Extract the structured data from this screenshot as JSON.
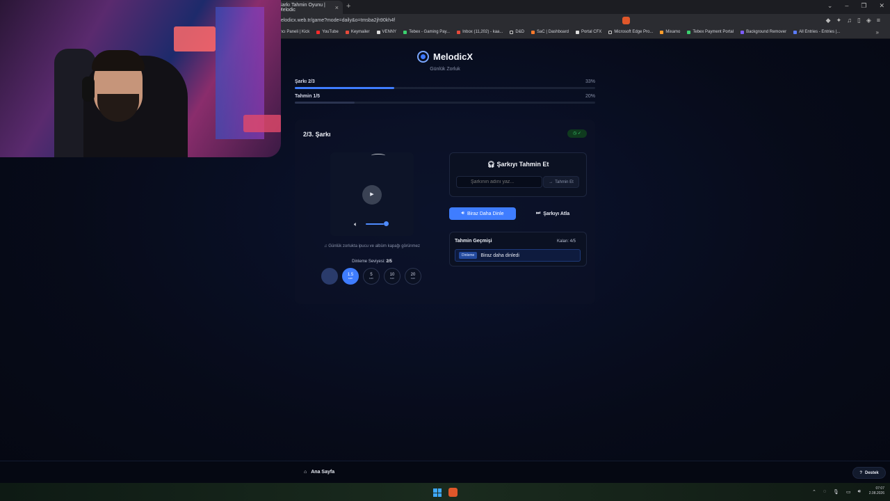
{
  "browser": {
    "tab_title": "Şarkı Tahmin Oyunu | Melodic",
    "url": "melodicx.web.tr/game?mode=daily&o=tmsba2jh90kh4f",
    "bookmarks": [
      "yıncı Paneli | Kick",
      "YouTube",
      "Keymailer",
      "VENNY",
      "Tebex - Gaming Pay...",
      "Inbox (11,202) - kaa...",
      "D&D",
      "SaC | Dashboard",
      "Portal CFX",
      "Microsoft Edge Pro...",
      "Mixamo",
      "Tebex Payment Portal",
      "Background Remover",
      "All Entries - Entries |..."
    ]
  },
  "header": {
    "logo_text": "MelodicX",
    "subtitle": "Günlük Zorluk"
  },
  "progress": {
    "song_label": "Şarkı 2/3",
    "song_pct": "33%",
    "song_fraction": 0.33,
    "guess_label": "Tahmin 1/5",
    "guess_pct": "20%",
    "guess_fraction": 0.2
  },
  "player": {
    "song_title": "2/3. Şarkı",
    "hint": "♫ Günlük zorlukta ipucu ve albüm kapağı görünmez",
    "volume_fraction": 0.85,
    "level_label": "Dinleme Seviyesi:",
    "level_value": "2/5",
    "levels": [
      {
        "value": "",
        "unit": ""
      },
      {
        "value": "1.5",
        "unit": "san"
      },
      {
        "value": "5",
        "unit": "san"
      },
      {
        "value": "10",
        "unit": "san"
      },
      {
        "value": "20",
        "unit": "san"
      }
    ]
  },
  "guess": {
    "title": "Şarkıyı Tahmin Et",
    "placeholder": "Şarkının adını yaz...",
    "submit_label": "Tahmin Et",
    "listen_more_label": "Biraz Daha Dinle",
    "skip_label": "Şarkıyı Atla"
  },
  "history": {
    "title": "Tahmin Geçmişi",
    "remaining": "Kalan: 4/5",
    "entries": [
      {
        "tag": "Dinleme",
        "text": "Biraz daha dinledi"
      }
    ]
  },
  "footer": {
    "home_label": "Ana Sayfa",
    "support_label": "Destek"
  },
  "taskbar": {
    "time": "07:07",
    "date": "2.08.2026"
  },
  "colors": {
    "accent": "#3f7dff",
    "background": "#060a16",
    "success": "#3bd16f"
  }
}
